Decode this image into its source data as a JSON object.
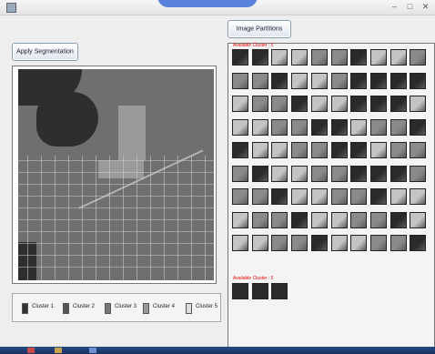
{
  "window": {
    "title": ""
  },
  "toolbar": {
    "image_partitions_label": "Image Partitions",
    "apply_segmentation_label": "Apply Segmentation"
  },
  "legend": [
    {
      "label": "Cluster 1",
      "color": "#333333"
    },
    {
      "label": "Cluster 2",
      "color": "#555555"
    },
    {
      "label": "Cluster 3",
      "color": "#777777"
    },
    {
      "label": "Cluster 4",
      "color": "#999999"
    },
    {
      "label": "Cluster 5",
      "color": "#dddddd"
    }
  ],
  "clusters": [
    {
      "caption": "Available Cluster : 5",
      "tile_count": 90
    },
    {
      "caption": "Available Cluster : 5",
      "tile_count": 3
    }
  ],
  "colors": {
    "caption": "#ee0000",
    "tile_dark": "#2a2a2a",
    "tile_mid": "#8a8a8a",
    "tile_light": "#c4c4c4"
  }
}
